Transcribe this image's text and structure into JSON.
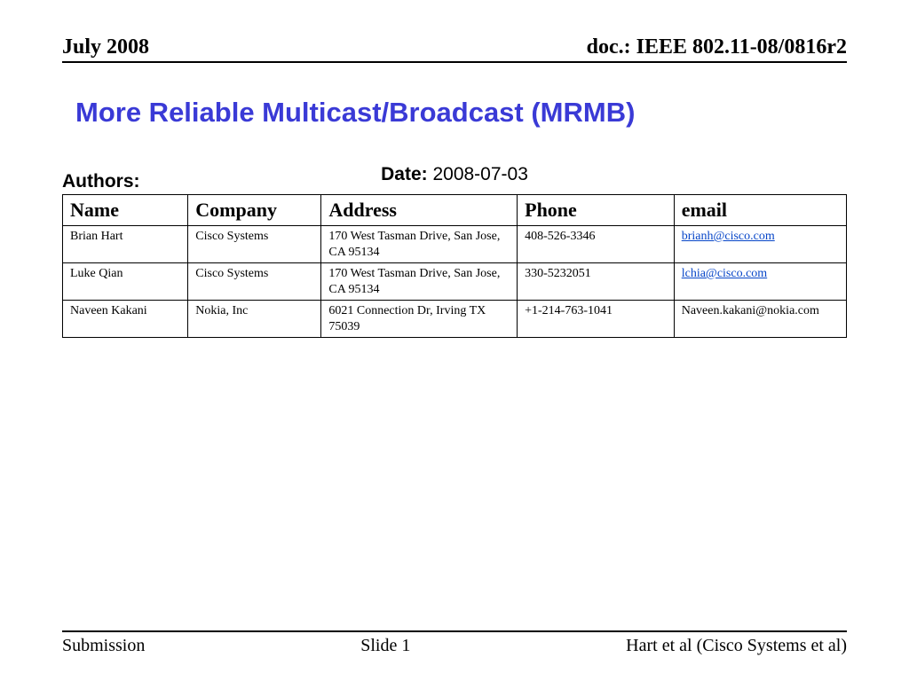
{
  "header": {
    "left": "July 2008",
    "right": "doc.: IEEE 802.11-08/0816r2"
  },
  "title": "More Reliable Multicast/Broadcast (MRMB)",
  "date": {
    "label": "Date:",
    "value": "2008-07-03"
  },
  "authors_label": "Authors:",
  "table": {
    "headers": {
      "name": "Name",
      "company": "Company",
      "address": "Address",
      "phone": "Phone",
      "email": "email"
    },
    "rows": [
      {
        "name": "Brian Hart",
        "company": "Cisco Systems",
        "address": "170 West Tasman Drive, San Jose, CA 95134",
        "phone": "408-526-3346",
        "email": "brianh@cisco.com",
        "email_link": true
      },
      {
        "name": "Luke Qian",
        "company": "Cisco Systems",
        "address": "170 West Tasman Drive, San Jose, CA 95134",
        "phone": "330-5232051",
        "email": "lchia@cisco.com",
        "email_link": true
      },
      {
        "name": "Naveen Kakani",
        "company": "Nokia, Inc",
        "address": "6021 Connection Dr, Irving TX 75039",
        "phone": "+1-214-763-1041",
        "email": "Naveen.kakani@nokia.com",
        "email_link": false
      }
    ]
  },
  "footer": {
    "left": "Submission",
    "center": "Slide 1",
    "right": "Hart et al (Cisco Systems et al)"
  }
}
